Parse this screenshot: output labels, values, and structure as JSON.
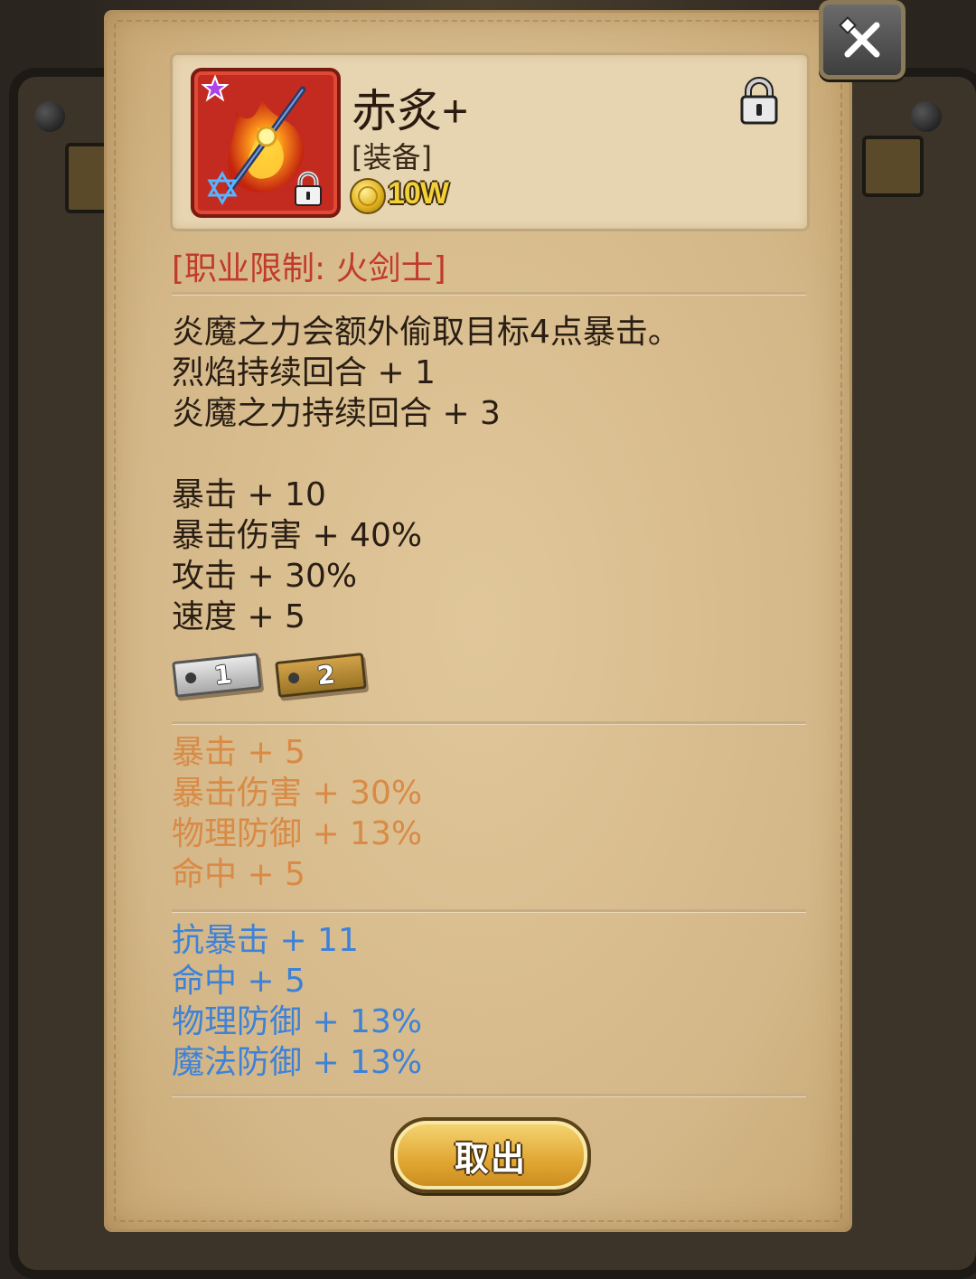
{
  "item": {
    "name": "赤炙+",
    "type": "[装备]",
    "price": "10W",
    "rarity_icon": "purple-star-icon",
    "class_icon": "hexagram-icon",
    "locked": true
  },
  "restriction": "[职业限制: 火剑士]",
  "description": [
    "炎魔之力会额外偷取目标4点暴击。",
    "烈焰持续回合 + 1",
    "炎魔之力持续回合 + 3"
  ],
  "base_stats": [
    "暴击 + 10",
    "暴击伤害 + 40%",
    "攻击 + 30%",
    "速度 + 5"
  ],
  "tags": [
    "1",
    "2"
  ],
  "tier1_stats": [
    "暴击 + 5",
    "暴击伤害 + 30%",
    "物理防御 + 13%",
    "命中 + 5"
  ],
  "tier2_stats": [
    "抗暴击 + 11",
    "命中 + 5",
    "物理防御 + 13%",
    "魔法防御 + 13%"
  ],
  "buttons": {
    "take_out": "取出"
  },
  "colors": {
    "restriction": "#c23a2a",
    "tier1": "#d98a45",
    "tier2": "#3e82d8",
    "price": "#f3cf3a"
  }
}
